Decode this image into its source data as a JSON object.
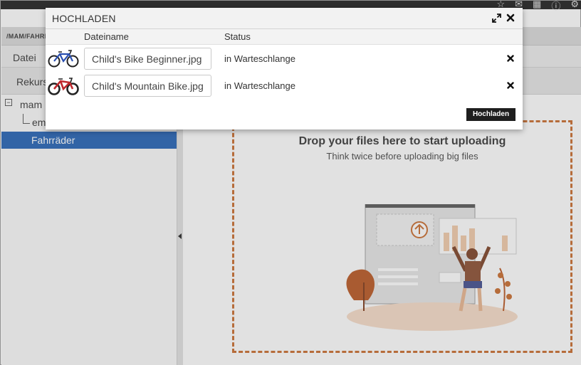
{
  "app": {
    "path": "/MAM/FAHRRÄDER",
    "menu_label": "Datei",
    "toolbar_label": "Rekursiv",
    "tree": {
      "root": "mam",
      "child": "empty",
      "selected": "Fahrräder"
    },
    "dropzone": {
      "title": "Drop your files here to start uploading",
      "subtitle": "Think twice before uploading big files"
    }
  },
  "dialog": {
    "title": "HOCHLADEN",
    "columns": {
      "name": "Dateiname",
      "status": "Status"
    },
    "files": [
      {
        "name": "Child's Bike Beginner.jpg",
        "status": "in Warteschlange",
        "thumb_color": "#2a4fb0"
      },
      {
        "name": "Child's Mountain Bike.jpg",
        "status": "in Warteschlange",
        "thumb_color": "#c0282d"
      }
    ],
    "upload_label": "Hochladen",
    "icons": {
      "expand": "expand-icon",
      "close": "close-icon",
      "remove": "remove-icon"
    }
  },
  "colors": {
    "selection": "#1f5fb4",
    "dropzone_border": "#c8692a",
    "button": "#1e1e1e"
  }
}
